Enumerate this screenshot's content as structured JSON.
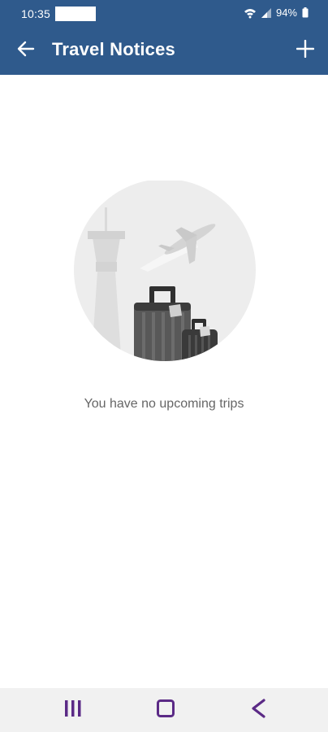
{
  "status_bar": {
    "time": "10:35",
    "battery": "94%",
    "icons": [
      "wifi-icon",
      "signal-icon",
      "battery-icon"
    ]
  },
  "app_bar": {
    "title": "Travel Notices",
    "back_icon": "back-arrow-icon",
    "add_icon": "plus-icon",
    "color": "#2f5a8c"
  },
  "empty_state": {
    "message": "You have no upcoming trips",
    "illustration": "airport-luggage-illustration"
  },
  "nav_bar": {
    "icons": [
      "recents-icon",
      "home-icon",
      "back-icon"
    ],
    "accent": "#5b2a86"
  }
}
